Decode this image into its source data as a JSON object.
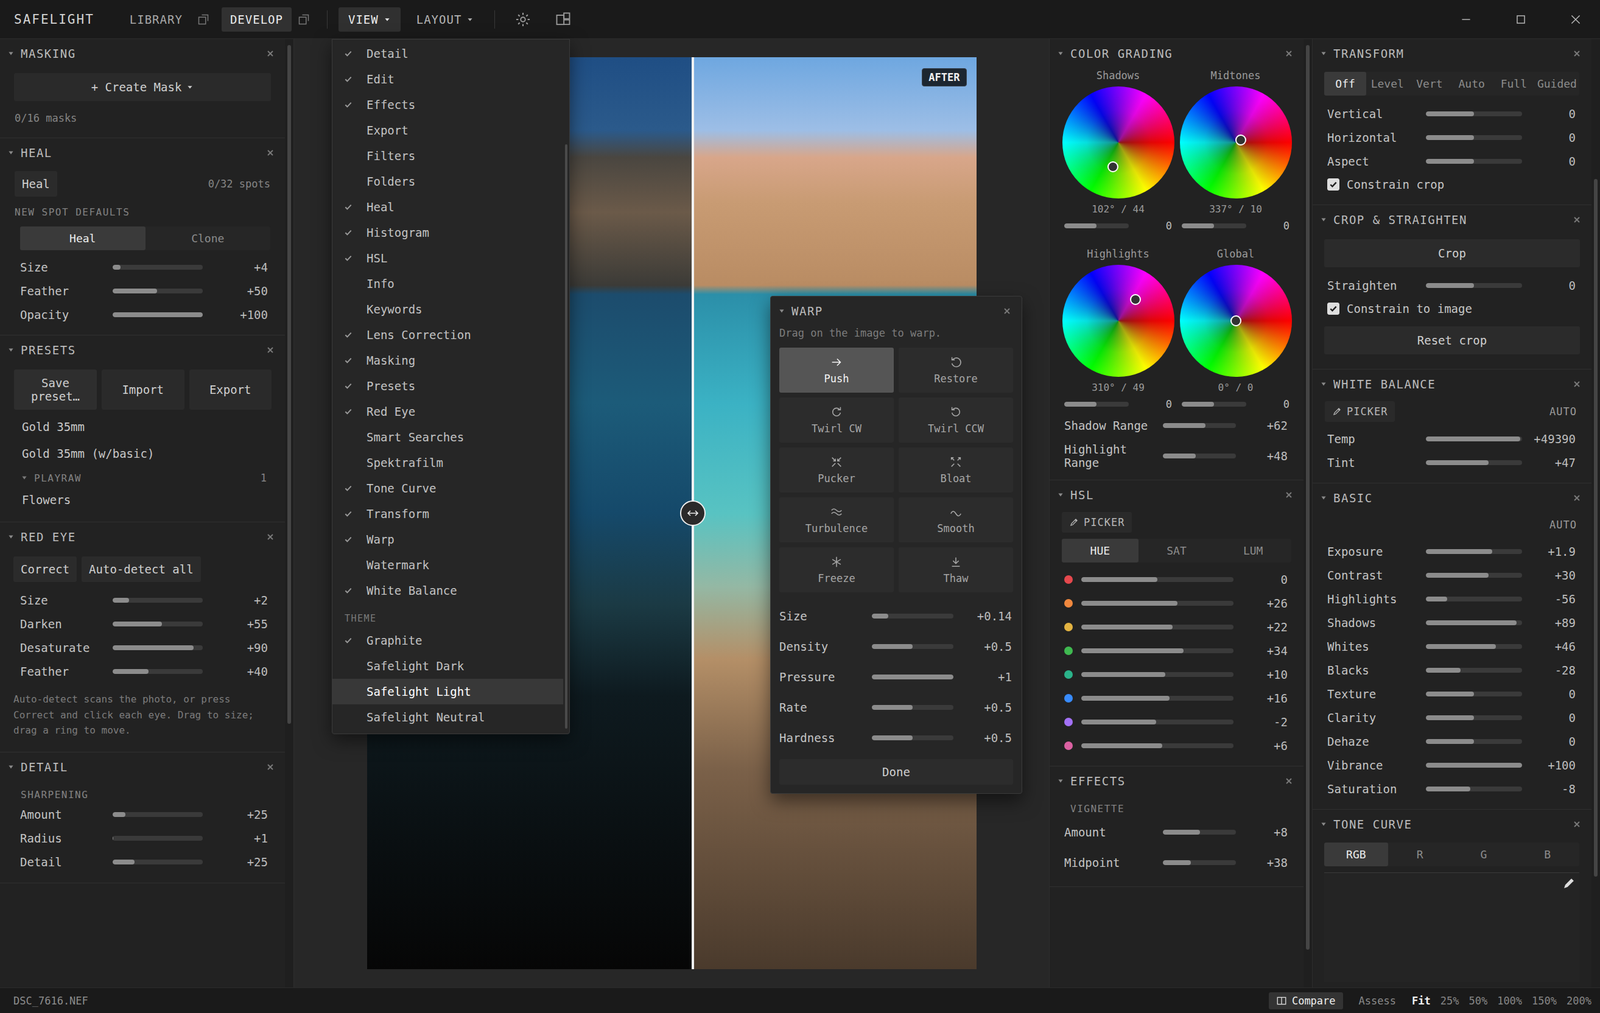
{
  "top_bar": {
    "app_name": "SAFELIGHT",
    "nav": [
      {
        "label": "LIBRARY",
        "selected": false
      },
      {
        "label": "DEVELOP",
        "selected": true
      }
    ],
    "menus": [
      {
        "label": "VIEW",
        "open": true
      },
      {
        "label": "LAYOUT",
        "open": false
      }
    ]
  },
  "masking": {
    "title": "MASKING",
    "button": "+ Create Mask",
    "count": "0/16 masks"
  },
  "heal": {
    "title": "HEAL",
    "tab": "Heal",
    "count": "0/32 spots",
    "defaults_label": "NEW SPOT DEFAULTS",
    "modes": [
      {
        "label": "Heal",
        "selected": true
      },
      {
        "label": "Clone",
        "selected": false
      }
    ],
    "sliders": [
      {
        "label": "Size",
        "value": "+4",
        "level": 0.09
      },
      {
        "label": "Feather",
        "value": "+50",
        "level": 0.49
      },
      {
        "label": "Opacity",
        "value": "+100",
        "level": 1
      }
    ]
  },
  "presets": {
    "title": "PRESETS",
    "buttons": [
      "Save preset…",
      "Import",
      "Export"
    ],
    "items": [
      "Gold 35mm",
      "Gold 35mm (w/basic)"
    ],
    "groups": [
      {
        "name": "PLAYRAW",
        "count": "1",
        "expanded": true,
        "items": [
          "Flowers"
        ]
      }
    ]
  },
  "red_eye": {
    "title": "RED EYE",
    "buttons": [
      "Correct",
      "Auto-detect all"
    ],
    "sliders": [
      {
        "label": "Size",
        "value": "+2",
        "level": 0.18
      },
      {
        "label": "Darken",
        "value": "+55",
        "level": 0.55
      },
      {
        "label": "Desaturate",
        "value": "+90",
        "level": 0.9
      },
      {
        "label": "Feather",
        "value": "+40",
        "level": 0.4
      }
    ],
    "note": "Auto-detect scans the photo, or press Correct and click each eye. Drag to size; drag a ring to move."
  },
  "detail": {
    "title": "DETAIL",
    "group": "SHARPENING",
    "sliders": [
      {
        "label": "Amount",
        "value": "+25",
        "level": 0.14
      },
      {
        "label": "Radius",
        "value": "+1",
        "level": 0.01
      },
      {
        "label": "Detail",
        "value": "+25",
        "level": 0.24
      }
    ]
  },
  "view_menu": {
    "items": [
      {
        "label": "Detail",
        "checked": true
      },
      {
        "label": "Edit",
        "checked": true
      },
      {
        "label": "Effects",
        "checked": true
      },
      {
        "label": "Export",
        "checked": false
      },
      {
        "label": "Filters",
        "checked": false
      },
      {
        "label": "Folders",
        "checked": false
      },
      {
        "label": "Heal",
        "checked": true
      },
      {
        "label": "Histogram",
        "checked": true
      },
      {
        "label": "HSL",
        "checked": true
      },
      {
        "label": "Info",
        "checked": false
      },
      {
        "label": "Keywords",
        "checked": false
      },
      {
        "label": "Lens Correction",
        "checked": true
      },
      {
        "label": "Masking",
        "checked": true
      },
      {
        "label": "Presets",
        "checked": true
      },
      {
        "label": "Red Eye",
        "checked": true
      },
      {
        "label": "Smart Searches",
        "checked": false
      },
      {
        "label": "Spektrafilm",
        "checked": false
      },
      {
        "label": "Tone Curve",
        "checked": true
      },
      {
        "label": "Transform",
        "checked": true
      },
      {
        "label": "Warp",
        "checked": true
      },
      {
        "label": "Watermark",
        "checked": false
      },
      {
        "label": "White Balance",
        "checked": true
      }
    ],
    "theme_label": "THEME",
    "themes": [
      {
        "label": "Graphite",
        "checked": true,
        "highlighted": false
      },
      {
        "label": "Safelight Dark",
        "checked": false,
        "highlighted": false
      },
      {
        "label": "Safelight Light",
        "checked": false,
        "highlighted": true
      },
      {
        "label": "Safelight Neutral",
        "checked": false,
        "highlighted": false
      }
    ]
  },
  "canvas": {
    "badge": "AFTER",
    "split": 0.535
  },
  "warp": {
    "title": "WARP",
    "hint": "Drag on the image to warp.",
    "tools": [
      {
        "label": "Push",
        "selected": true
      },
      {
        "label": "Restore",
        "selected": false
      },
      {
        "label": "Twirl CW",
        "selected": false
      },
      {
        "label": "Twirl CCW",
        "selected": false
      },
      {
        "label": "Pucker",
        "selected": false
      },
      {
        "label": "Bloat",
        "selected": false
      },
      {
        "label": "Turbulence",
        "selected": false
      },
      {
        "label": "Smooth",
        "selected": false
      },
      {
        "label": "Freeze",
        "selected": false
      },
      {
        "label": "Thaw",
        "selected": false
      }
    ],
    "sliders": [
      {
        "label": "Size",
        "value": "+0.14",
        "level": 0.2
      },
      {
        "label": "Density",
        "value": "+0.5",
        "level": 0.5
      },
      {
        "label": "Pressure",
        "value": "+1",
        "level": 1
      },
      {
        "label": "Rate",
        "value": "+0.5",
        "level": 0.5
      },
      {
        "label": "Hardness",
        "value": "+0.5",
        "level": 0.5
      }
    ],
    "done": "Done"
  },
  "color_grading": {
    "title": "COLOR GRADING",
    "wheels": [
      {
        "label": "Shadows",
        "hue": 102,
        "sat": 44,
        "reading": "102° / 44",
        "value": "0",
        "level": 0.5
      },
      {
        "label": "Midtones",
        "hue": 337,
        "sat": 10,
        "reading": "337° / 10",
        "value": "0",
        "level": 0.5
      },
      {
        "label": "Highlights",
        "hue": 310,
        "sat": 49,
        "reading": "310° / 49",
        "value": "0",
        "level": 0.5
      },
      {
        "label": "Global",
        "hue": 0,
        "sat": 0,
        "reading": "0° / 0",
        "value": "0",
        "level": 0.5
      }
    ],
    "ranges": [
      {
        "label": "Shadow Range",
        "value": "+62",
        "level": 0.58
      },
      {
        "label": "Highlight Range",
        "value": "+48",
        "level": 0.45
      }
    ]
  },
  "hsl": {
    "title": "HSL",
    "picker": "PICKER",
    "tabs": [
      {
        "label": "HUE",
        "selected": true
      },
      {
        "label": "SAT",
        "selected": false
      },
      {
        "label": "LUM",
        "selected": false
      }
    ],
    "rows": [
      {
        "color": "#e5484d",
        "value": "0",
        "level": 0.5
      },
      {
        "color": "#f0883e",
        "value": "+26",
        "level": 0.63
      },
      {
        "color": "#e3b341",
        "value": "+22",
        "level": 0.6
      },
      {
        "color": "#3fb950",
        "value": "+34",
        "level": 0.67
      },
      {
        "color": "#2bb38a",
        "value": "+10",
        "level": 0.55
      },
      {
        "color": "#388bfd",
        "value": "+16",
        "level": 0.58
      },
      {
        "color": "#a371f7",
        "value": "-2",
        "level": 0.49
      },
      {
        "color": "#db61a2",
        "value": "+6",
        "level": 0.53
      }
    ]
  },
  "effects": {
    "title": "EFFECTS",
    "group": "VIGNETTE",
    "sliders": [
      {
        "label": "Amount",
        "value": "+8",
        "level": 0.51
      },
      {
        "label": "Midpoint",
        "value": "+38",
        "level": 0.38
      }
    ]
  },
  "transform": {
    "title": "TRANSFORM",
    "modes": [
      {
        "label": "Off",
        "selected": true
      },
      {
        "label": "Level",
        "selected": false
      },
      {
        "label": "Vert",
        "selected": false
      },
      {
        "label": "Auto",
        "selected": false
      },
      {
        "label": "Full",
        "selected": false
      },
      {
        "label": "Guided",
        "selected": false
      }
    ],
    "sliders": [
      {
        "label": "Vertical",
        "value": "0",
        "level": 0.5
      },
      {
        "label": "Horizontal",
        "value": "0",
        "level": 0.5
      },
      {
        "label": "Aspect",
        "value": "0",
        "level": 0.5
      }
    ],
    "checkbox": {
      "label": "Constrain crop",
      "checked": true
    }
  },
  "crop": {
    "title": "CROP & STRAIGHTEN",
    "button": "Crop",
    "sliders": [
      {
        "label": "Straighten",
        "value": "0",
        "level": 0.5
      }
    ],
    "checkbox": {
      "label": "Constrain to image",
      "checked": true
    },
    "reset": "Reset crop"
  },
  "white_balance": {
    "title": "WHITE BALANCE",
    "picker": "PICKER",
    "auto": "AUTO",
    "sliders": [
      {
        "label": "Temp",
        "value": "+49390",
        "level": 0.98
      },
      {
        "label": "Tint",
        "value": "+47",
        "level": 0.65
      }
    ]
  },
  "basic": {
    "title": "BASIC",
    "auto": "AUTO",
    "sliders": [
      {
        "label": "Exposure",
        "value": "+1.9",
        "level": 0.69
      },
      {
        "label": "Contrast",
        "value": "+30",
        "level": 0.65
      },
      {
        "label": "Highlights",
        "value": "-56",
        "level": 0.22
      },
      {
        "label": "Shadows",
        "value": "+89",
        "level": 0.94
      },
      {
        "label": "Whites",
        "value": "+46",
        "level": 0.73
      },
      {
        "label": "Blacks",
        "value": "-28",
        "level": 0.36
      },
      {
        "label": "Texture",
        "value": "0",
        "level": 0.5
      },
      {
        "label": "Clarity",
        "value": "0",
        "level": 0.5
      },
      {
        "label": "Dehaze",
        "value": "0",
        "level": 0.5
      },
      {
        "label": "Vibrance",
        "value": "+100",
        "level": 1
      },
      {
        "label": "Saturation",
        "value": "-8",
        "level": 0.46
      }
    ]
  },
  "tone_curve": {
    "title": "TONE CURVE",
    "channels": [
      {
        "label": "RGB",
        "selected": true
      },
      {
        "label": "R",
        "selected": false
      },
      {
        "label": "G",
        "selected": false
      },
      {
        "label": "B",
        "selected": false
      }
    ]
  },
  "status_bar": {
    "file": "DSC_7616.NEF",
    "compare": {
      "label": "Compare",
      "active": true
    },
    "assess": "Assess",
    "zoom": [
      {
        "label": "Fit",
        "selected": true
      },
      {
        "label": "25%",
        "selected": false
      },
      {
        "label": "50%",
        "selected": false
      },
      {
        "label": "100%",
        "selected": false
      },
      {
        "label": "150%",
        "selected": false
      },
      {
        "label": "200%",
        "selected": false
      }
    ]
  }
}
